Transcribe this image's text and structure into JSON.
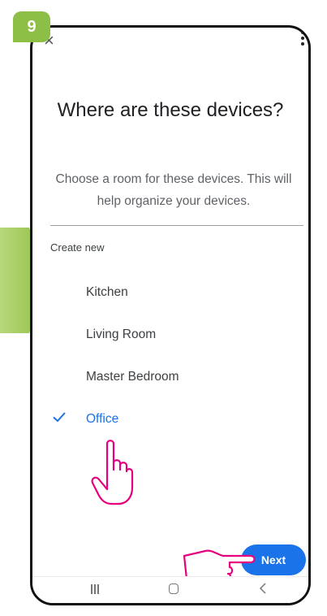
{
  "badge": {
    "step_number": "9"
  },
  "header": {
    "close_icon": "×"
  },
  "main": {
    "title": "Where are these devices?",
    "subtitle": "Choose a room for these devices. This will help organize your devices.",
    "create_new_label": "Create new",
    "rooms": [
      {
        "label": "Kitchen",
        "selected": false
      },
      {
        "label": "Living Room",
        "selected": false
      },
      {
        "label": "Master Bedroom",
        "selected": false
      },
      {
        "label": "Office",
        "selected": true
      }
    ]
  },
  "footer": {
    "next_label": "Next"
  },
  "colors": {
    "accent": "#1a73e8",
    "badge": "#8dbe45",
    "annotation": "#e6007e"
  },
  "icons": {
    "close": "close-icon",
    "menu": "more-vert-icon",
    "check": "check-icon",
    "nav": [
      "recent-apps-icon",
      "home-icon",
      "back-icon"
    ],
    "annotations": [
      "hand-tap-icon",
      "hand-point-icon"
    ]
  }
}
